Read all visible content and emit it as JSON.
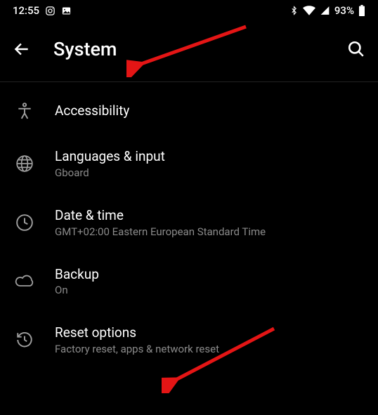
{
  "statusbar": {
    "time": "12:55",
    "left_icons": [
      "instagram-icon",
      "image-icon"
    ],
    "right_icons": [
      "bluetooth-icon",
      "wifi-icon",
      "signal-icon"
    ],
    "battery_pct": "93%",
    "battery_icon": "battery-icon"
  },
  "header": {
    "back_icon": "arrow-left-icon",
    "title": "System",
    "search_icon": "search-icon"
  },
  "items": [
    {
      "icon": "accessibility-icon",
      "label": "Accessibility",
      "sub": ""
    },
    {
      "icon": "globe-icon",
      "label": "Languages & input",
      "sub": "Gboard"
    },
    {
      "icon": "clock-icon",
      "label": "Date & time",
      "sub": "GMT+02:00 Eastern European Standard Time"
    },
    {
      "icon": "cloud-icon",
      "label": "Backup",
      "sub": "On"
    },
    {
      "icon": "restore-icon",
      "label": "Reset options",
      "sub": "Factory reset, apps & network reset"
    }
  ],
  "annotations": {
    "arrow1_target": "header.title",
    "arrow2_target": "items.4.label"
  }
}
